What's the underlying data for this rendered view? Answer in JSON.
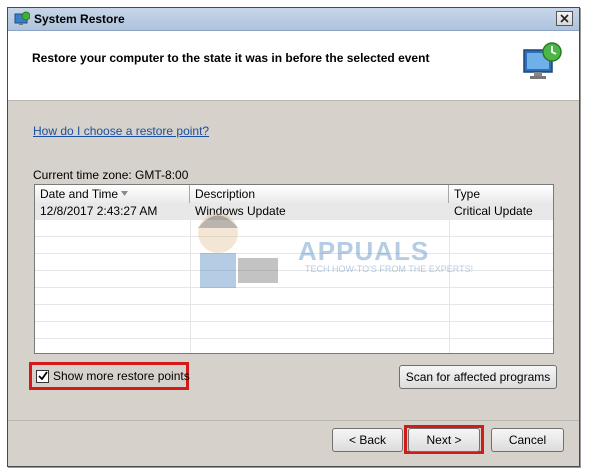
{
  "window": {
    "title": "System Restore",
    "icons": {
      "app": "system-restore-icon",
      "close": "close-icon",
      "header": "restore-computer-icon"
    }
  },
  "header": {
    "title": "Restore your computer to the state it was in before the selected event"
  },
  "help_link": "How do I choose a restore point?",
  "timezone": "Current time zone: GMT-8:00",
  "table": {
    "columns": [
      "Date and Time",
      "Description",
      "Type"
    ],
    "sort_icon": "sort-down-icon",
    "rows": [
      {
        "date": "12/8/2017 2:43:27 AM",
        "description": "Windows Update",
        "type": "Critical Update"
      }
    ]
  },
  "watermark": {
    "title": "APPUALS",
    "subtitle": "TECH HOW-TO'S FROM THE EXPERTS!"
  },
  "show_more": {
    "label": "Show more restore points",
    "checked": true
  },
  "buttons": {
    "scan": "Scan for affected programs",
    "back": "< Back",
    "next": "Next >",
    "cancel": "Cancel"
  },
  "colors": {
    "highlight": "#d11a1a",
    "link": "#1a4fa0"
  }
}
